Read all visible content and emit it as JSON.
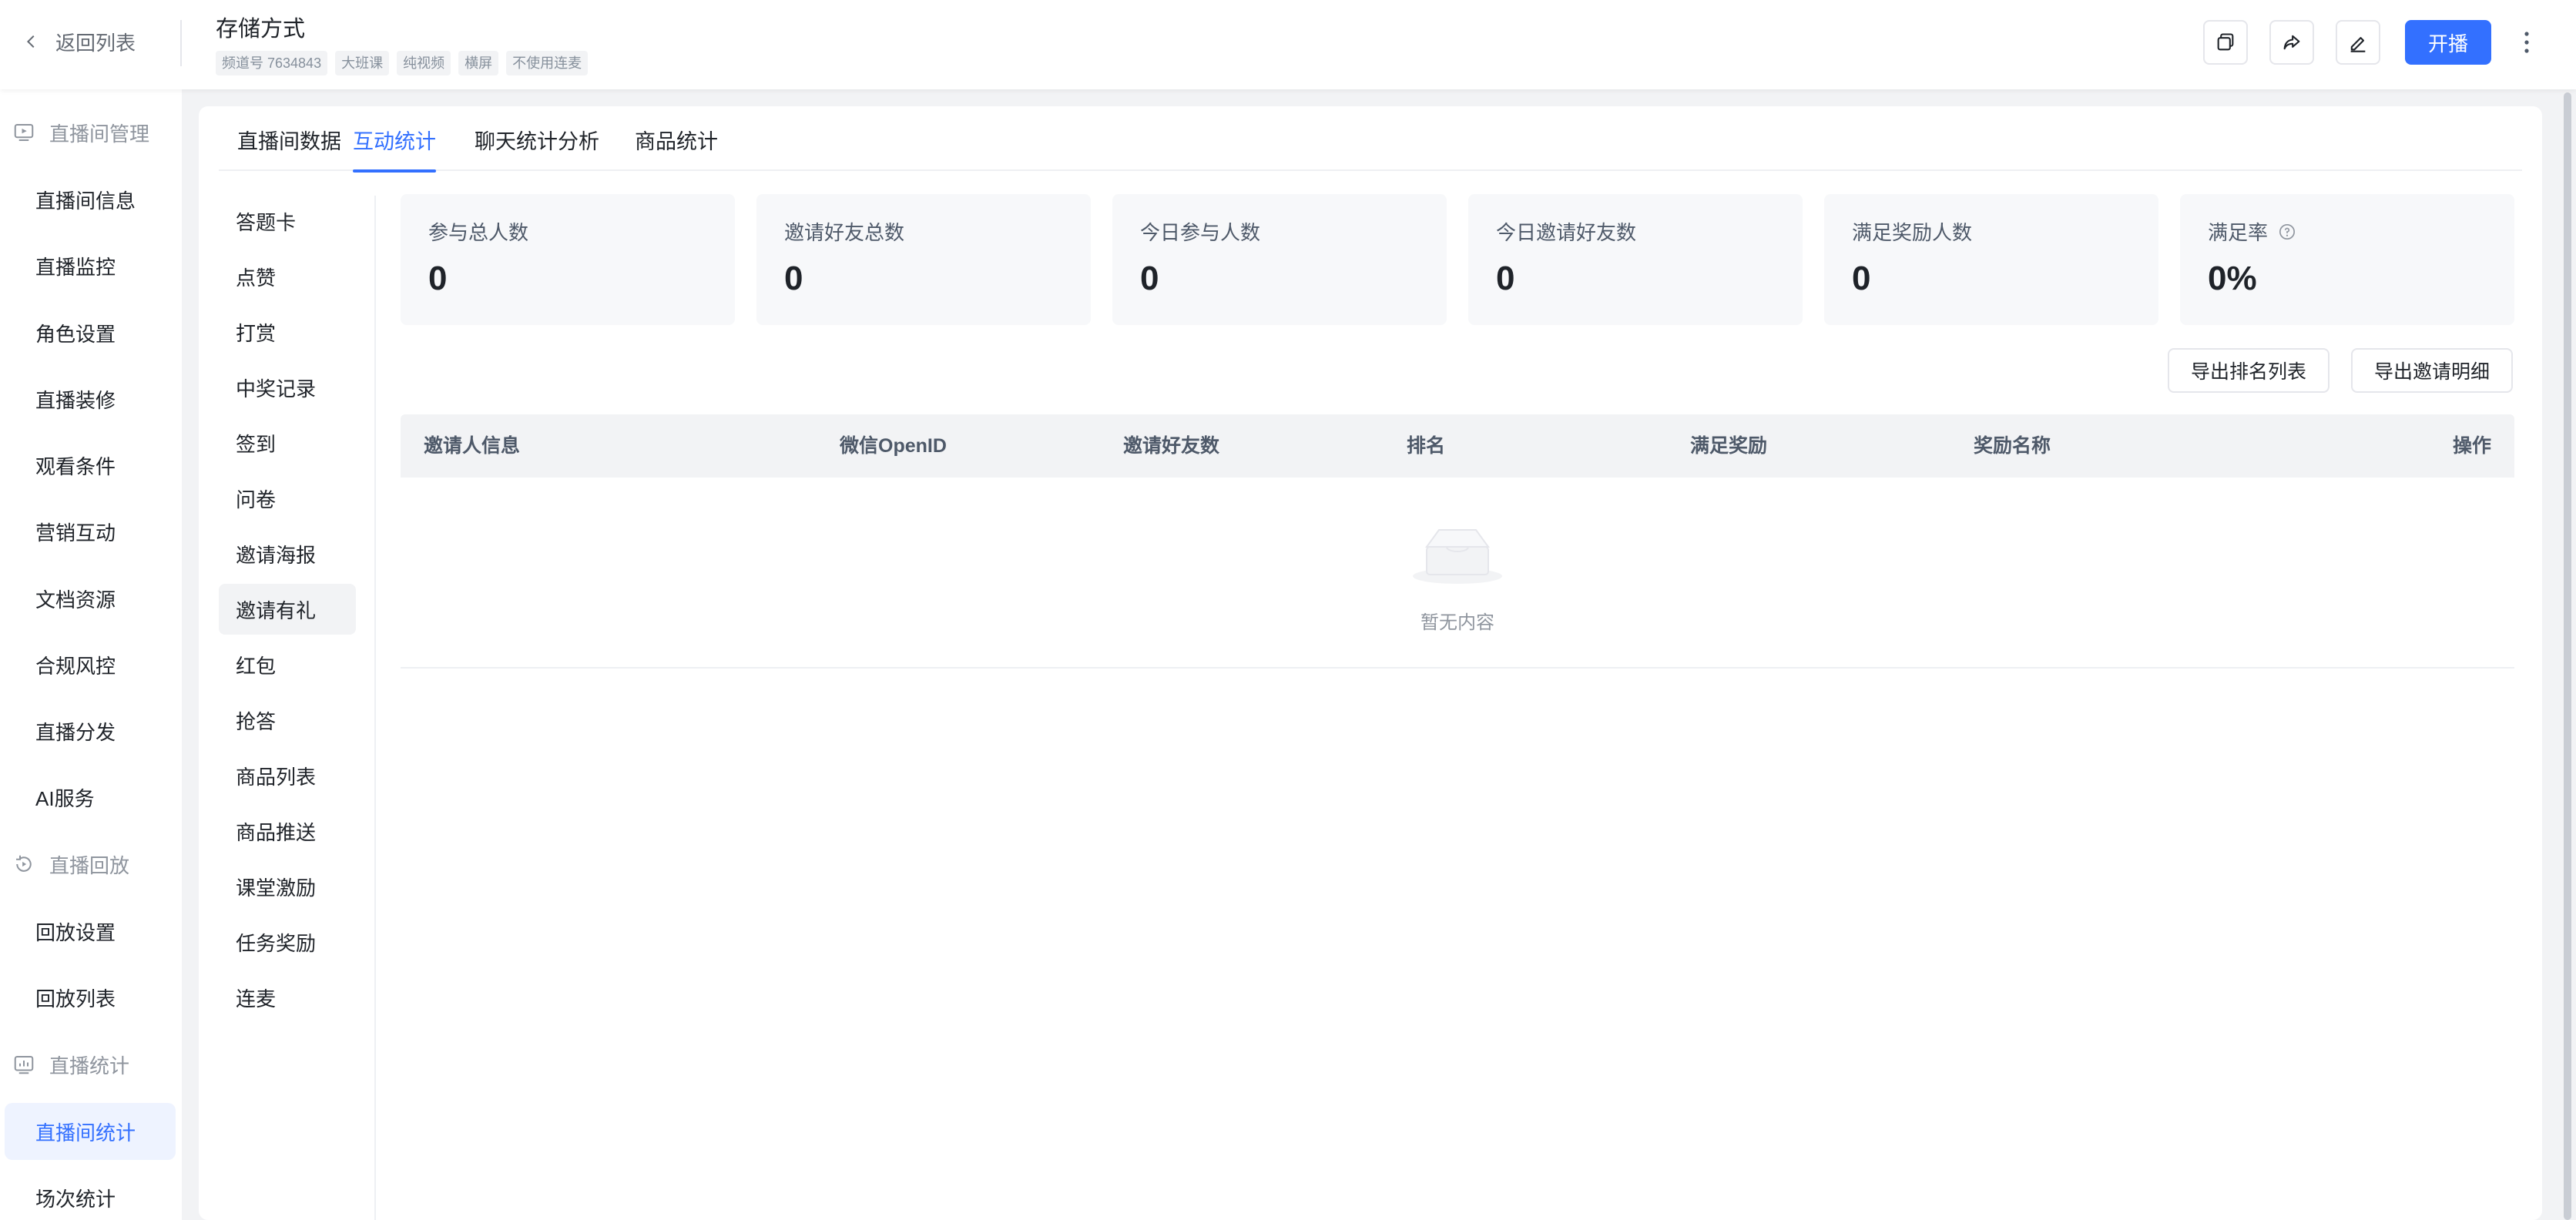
{
  "header": {
    "back_label": "返回列表",
    "title": "存储方式",
    "tags": [
      "频道号 7634843",
      "大班课",
      "纯视频",
      "横屏",
      "不使用连麦"
    ],
    "start_label": "开播",
    "icons": [
      "copy-icon",
      "share-icon",
      "edit-icon",
      "more-vertical-icon"
    ],
    "accent": "#3370ff"
  },
  "sidebar": {
    "groups": [
      {
        "label": "直播间管理",
        "icon": "live-room-icon"
      },
      {
        "label": "直播回放",
        "icon": "replay-icon"
      },
      {
        "label": "直播统计",
        "icon": "statistics-icon"
      }
    ],
    "items": [
      {
        "label": "直播间信息"
      },
      {
        "label": "直播监控"
      },
      {
        "label": "角色设置"
      },
      {
        "label": "直播装修"
      },
      {
        "label": "观看条件"
      },
      {
        "label": "营销互动"
      },
      {
        "label": "文档资源"
      },
      {
        "label": "合规风控"
      },
      {
        "label": "直播分发"
      },
      {
        "label": "AI服务"
      },
      {
        "label": "回放设置"
      },
      {
        "label": "回放列表"
      },
      {
        "label": "直播间统计"
      },
      {
        "label": "场次统计"
      }
    ],
    "active": "直播间统计"
  },
  "tabs": [
    "直播间数据",
    "互动统计",
    "聊天统计分析",
    "商品统计"
  ],
  "active_tab": "互动统计",
  "sub_menu": [
    "答题卡",
    "点赞",
    "打赏",
    "中奖记录",
    "签到",
    "问卷",
    "邀请海报",
    "邀请有礼",
    "红包",
    "抢答",
    "商品列表",
    "商品推送",
    "课堂激励",
    "任务奖励",
    "连麦"
  ],
  "active_sub": "邀请有礼",
  "stats": [
    {
      "label": "参与总人数",
      "value": "0"
    },
    {
      "label": "邀请好友总数",
      "value": "0"
    },
    {
      "label": "今日参与人数",
      "value": "0"
    },
    {
      "label": "今日邀请好友数",
      "value": "0"
    },
    {
      "label": "满足奖励人数",
      "value": "0"
    },
    {
      "label": "满足率",
      "value": "0%",
      "icon": "help-icon"
    }
  ],
  "exports": {
    "rank_list": "导出排名列表",
    "invite_detail": "导出邀请明细"
  },
  "table": {
    "columns": [
      "邀请人信息",
      "微信OpenID",
      "邀请好友数",
      "排名",
      "满足奖励",
      "奖励名称",
      "操作"
    ],
    "empty_text": "暂无内容"
  }
}
